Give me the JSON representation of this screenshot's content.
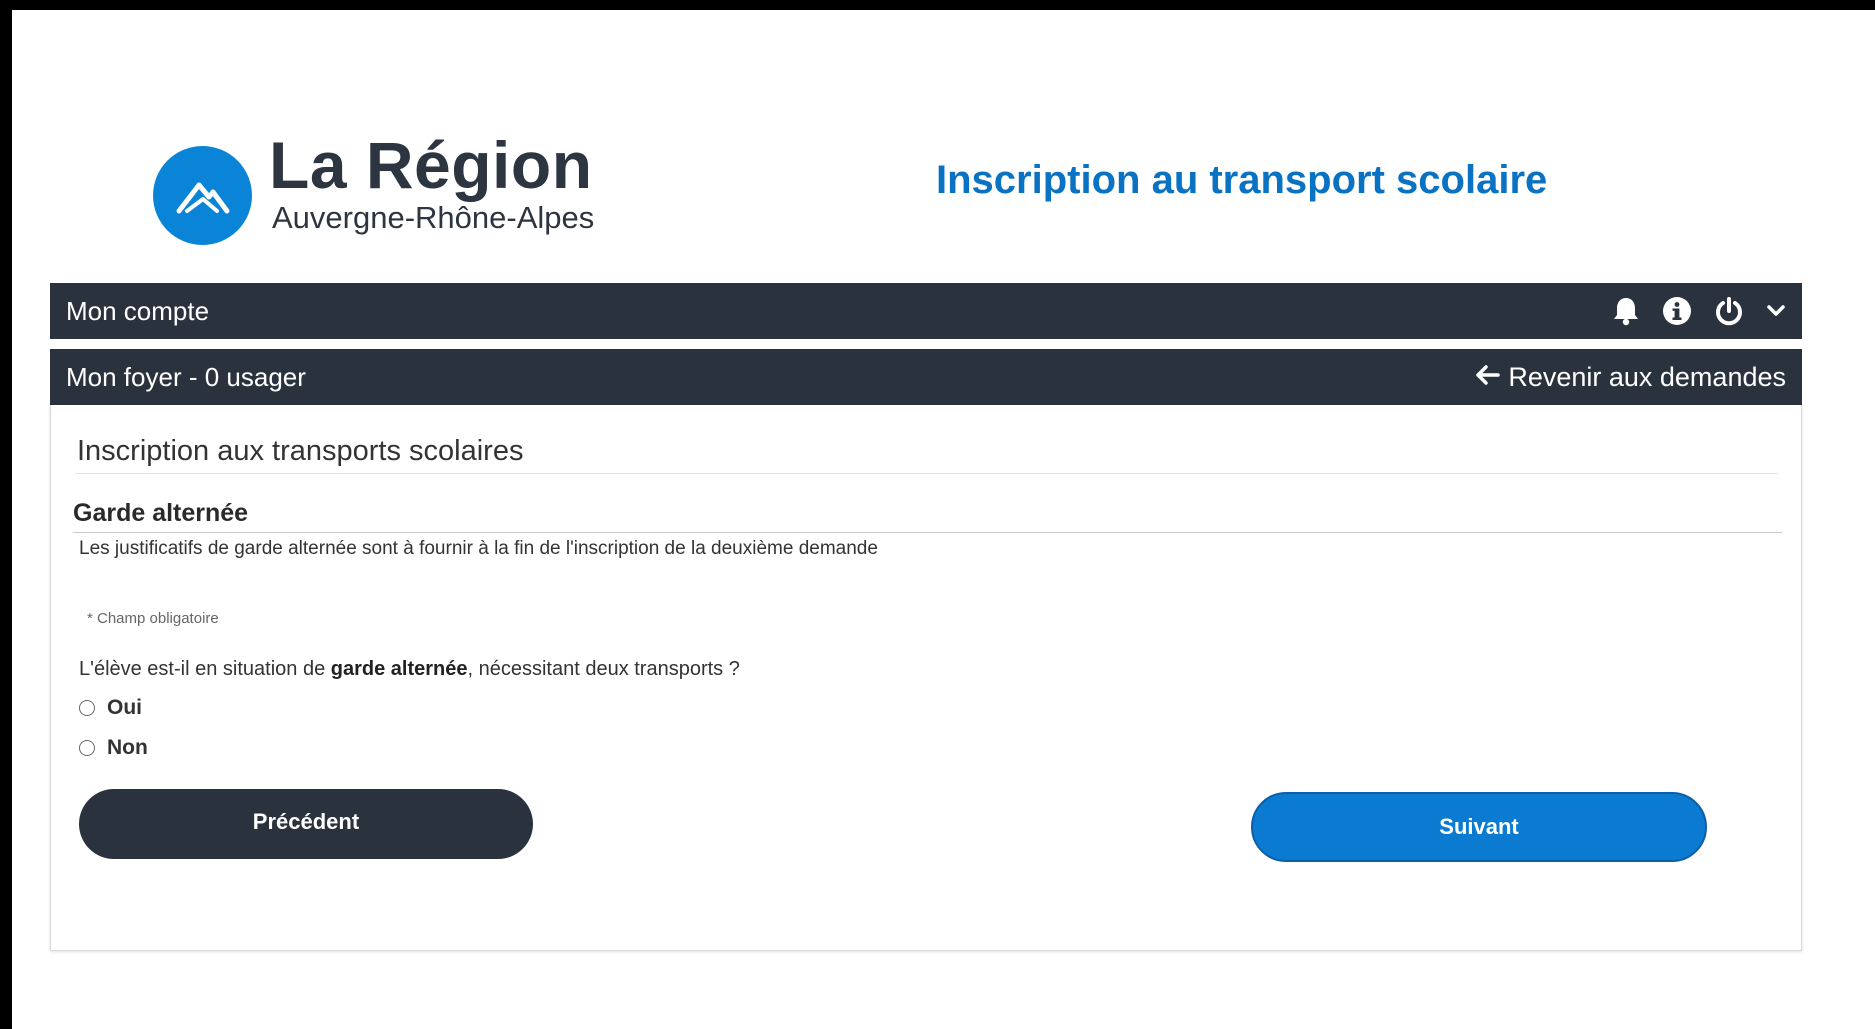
{
  "header": {
    "logo": {
      "name": "La Région",
      "subtitle": "Auvergne-Rhône-Alpes",
      "color": "#0a84d6"
    },
    "title": "Inscription au transport scolaire"
  },
  "account_bar": {
    "label": "Mon compte",
    "icons": [
      "bell-icon",
      "info-icon",
      "power-icon",
      "chevron-down-icon"
    ]
  },
  "household_bar": {
    "label": "Mon foyer - 0 usager",
    "back_link": "Revenir aux demandes"
  },
  "form": {
    "title": "Inscription aux transports scolaires",
    "section_title": "Garde alternée",
    "section_note": "Les justificatifs de garde alternée sont à fournir à la fin de l'inscription de la deuxième demande",
    "required_note": "* Champ obligatoire",
    "question": {
      "before": "L'élève est-il en situation de ",
      "emphasis": "garde alternée",
      "after": ", nécessitant deux transports ?"
    },
    "options": [
      {
        "label": "Oui",
        "selected": false
      },
      {
        "label": "Non",
        "selected": false
      }
    ],
    "buttons": {
      "previous": "Précédent",
      "next": "Suivant"
    }
  },
  "colors": {
    "dark_bar": "#2a323d",
    "title_blue": "#0a72c2",
    "next_button": "#0a7bd0"
  }
}
